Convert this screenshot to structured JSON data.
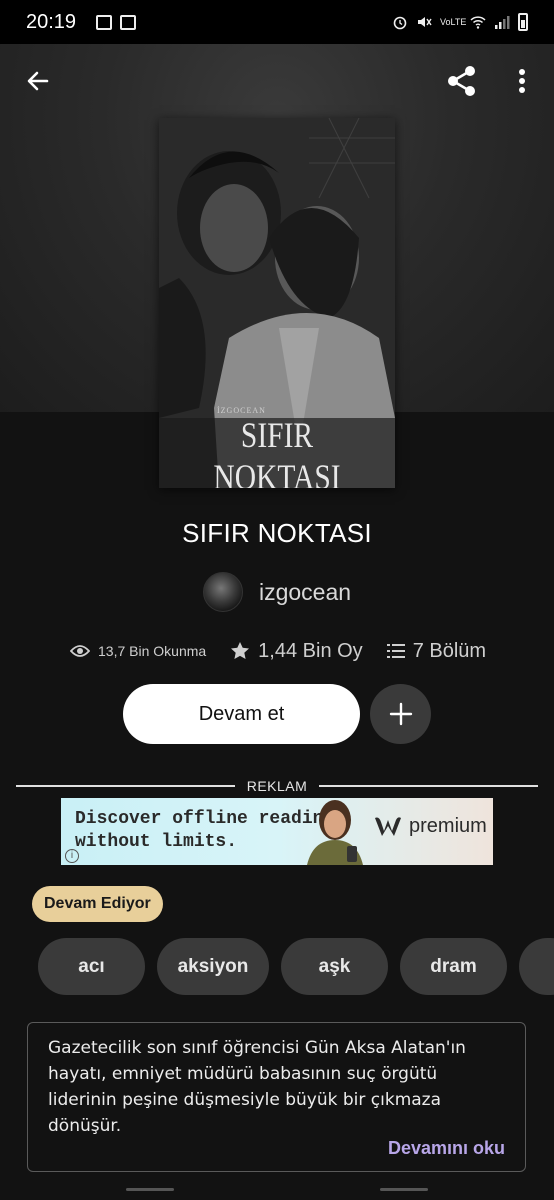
{
  "status_bar": {
    "time": "20:19",
    "network": "VoLTE"
  },
  "top_bar": {
    "back_icon": "arrow-left-icon",
    "share_icon": "share-icon",
    "more_icon": "more-vert-icon"
  },
  "cover": {
    "author_text": "İZGOCEAN",
    "title_text": "SIFIR NOKTASI"
  },
  "book": {
    "title": "SIFIR NOKTASI",
    "author": "izgocean"
  },
  "stats": {
    "reads": "13,7 Bin Okunma",
    "votes": "1,44 Bin Oy",
    "parts": "7 Bölüm"
  },
  "actions": {
    "continue_label": "Devam et",
    "add_icon": "plus-icon"
  },
  "ad": {
    "label": "REKLAM",
    "line1": "Discover offline reading",
    "line2": "without limits.",
    "brand": "premium"
  },
  "status_badge": "Devam Ediyor",
  "tags": [
    "acı",
    "aksiyon",
    "aşk",
    "dram"
  ],
  "description": {
    "text": "Gazetecilik son sınıf öğrencisi Gün Aksa Alatan'ın hayatı, emniyet müdürü babasının suç örgütü liderinin peşine düşmesiyle büyük bir çıkmaza dönüşür.",
    "read_more": "Devamını oku"
  },
  "colors": {
    "background": "#121212",
    "badge": "#e8cf9a",
    "read_more": "#b8a6e8",
    "tag_bg": "#3a3a3a"
  }
}
